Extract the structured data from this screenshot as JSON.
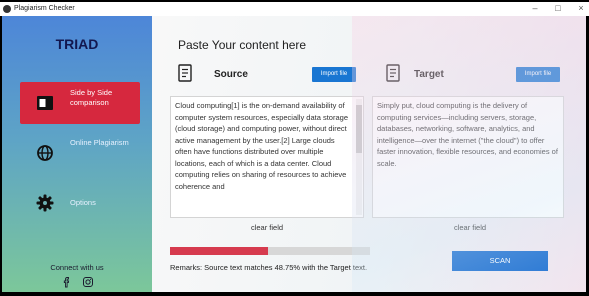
{
  "window": {
    "title": "Plagiarism Checker",
    "controls": [
      "–",
      "□",
      "×"
    ]
  },
  "sidebar": {
    "logo": "TRIAD",
    "items": [
      {
        "label": "Side by Side comparison",
        "icon": "id-card-icon",
        "active": true
      },
      {
        "label": "Online Plagiarism",
        "icon": "globe-icon",
        "active": false
      },
      {
        "label": "Options",
        "icon": "gear-icon",
        "active": false
      }
    ],
    "connect_label": "Connect with us",
    "social": [
      "facebook-icon",
      "instagram-icon"
    ]
  },
  "main": {
    "heading": "Paste Your content here",
    "source": {
      "title": "Source",
      "import_label": "Import file",
      "text": "Cloud computing[1] is the on-demand availability of computer system resources, especially data storage (cloud storage) and computing power, without direct active management by the user.[2] Large clouds often have functions distributed over multiple locations, each of which is a data center. Cloud computing relies on sharing of resources to achieve coherence and",
      "clear_label": "clear field"
    },
    "target": {
      "title": "Target",
      "import_label": "Import file",
      "text": "Simply put, cloud computing is the delivery of computing services—including servers, storage, databases, networking, software, analytics, and intelligence—over the internet (\"the cloud\") to offer faster innovation, flexible resources, and economies of scale.",
      "clear_label": "clear field"
    },
    "match_percent": 48.75,
    "remarks": "Remarks: Source text matches 48.75% with the Target text.",
    "scan_label": "SCAN"
  },
  "colors": {
    "accent": "#1c6fd1",
    "active_nav": "#d6283e",
    "progress_fill": "#d63a4e"
  }
}
